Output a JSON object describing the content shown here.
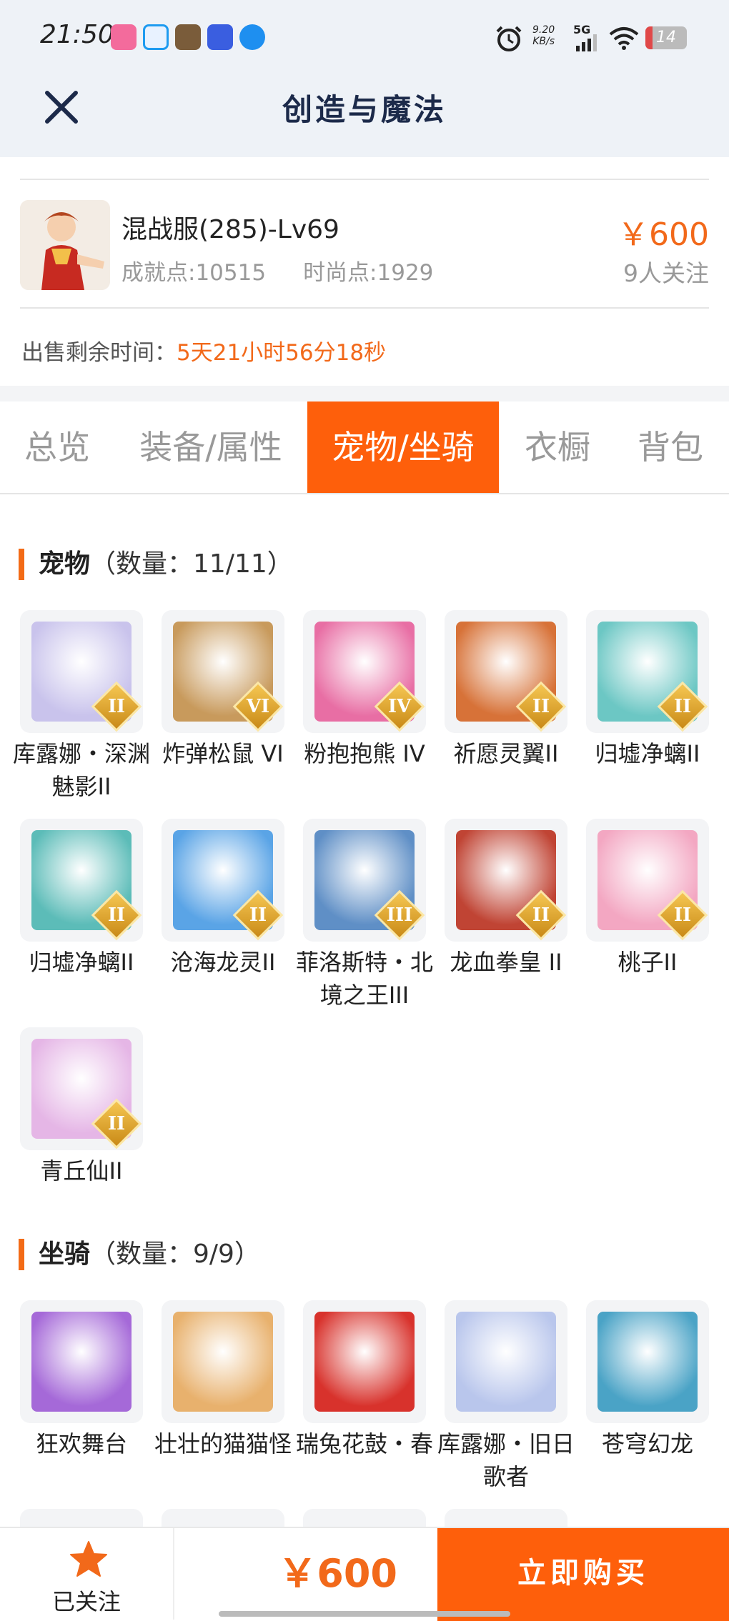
{
  "status_bar": {
    "time": "21:50",
    "net_speed_value": "9.20",
    "net_speed_unit": "KB/s",
    "network": "5G",
    "battery": "14",
    "apps": [
      {
        "name": "bilibili-icon",
        "color": "#f36b9c"
      },
      {
        "name": "qq-icon",
        "color": "#1e9bf0"
      },
      {
        "name": "game-icon",
        "color": "#7a5c3a"
      },
      {
        "name": "tieba-icon",
        "color": "#3a5ee0"
      },
      {
        "name": "k-app-icon",
        "color": "#1e8ff0"
      }
    ]
  },
  "nav": {
    "title": "创造与魔法"
  },
  "product": {
    "name": "混战服(285)-Lv69",
    "achievement": "成就点:10515",
    "fashion": "时尚点:1929",
    "price": "￥600",
    "followers": "9人关注"
  },
  "sale": {
    "label": "出售剩余时间：",
    "remaining": "5天21小时56分18秒"
  },
  "tabs": [
    {
      "label": "总览",
      "active": false
    },
    {
      "label": "装备/属性",
      "active": false
    },
    {
      "label": "宠物/坐骑",
      "active": true
    },
    {
      "label": "衣橱",
      "active": false
    },
    {
      "label": "背包",
      "active": false
    }
  ],
  "pets": {
    "title": "宠物",
    "count": "（数量：11/11）",
    "items": [
      {
        "label": "库露娜・深渊魅影II",
        "badge": "II",
        "color": "#c9c3ec"
      },
      {
        "label": "炸弹松鼠 VI",
        "badge": "VI",
        "color": "#c89a5c"
      },
      {
        "label": "粉抱抱熊 IV",
        "badge": "IV",
        "color": "#e86ea4"
      },
      {
        "label": "祈愿灵翼II",
        "badge": "II",
        "color": "#d77238"
      },
      {
        "label": "归墟净螭II",
        "badge": "II",
        "color": "#6cc7c4"
      },
      {
        "label": "归墟净螭II",
        "badge": "II",
        "color": "#5cbcb8"
      },
      {
        "label": "沧海龙灵II",
        "badge": "II",
        "color": "#5aa4e6"
      },
      {
        "label": "菲洛斯特・北境之王III",
        "badge": "III",
        "color": "#5f8fc6"
      },
      {
        "label": "龙血拳皇 II",
        "badge": "II",
        "color": "#c04434"
      },
      {
        "label": "桃子II",
        "badge": "II",
        "color": "#f3a7c2"
      },
      {
        "label": "青丘仙II",
        "badge": "II",
        "color": "#e5b6e6"
      }
    ]
  },
  "mounts": {
    "title": "坐骑",
    "count": "（数量：9/9）",
    "items": [
      {
        "label": "狂欢舞台",
        "color": "#a569d8"
      },
      {
        "label": "壮壮的猫猫怪",
        "color": "#e8b16d"
      },
      {
        "label": "瑞兔花鼓・春",
        "color": "#d8322c"
      },
      {
        "label": "库露娜・旧日歌者",
        "color": "#b9c6ec"
      },
      {
        "label": "苍穹幻龙",
        "color": "#4aa3c6"
      }
    ]
  },
  "bottom": {
    "follow_label": "已关注",
    "price": "￥600",
    "buy_label": "立即购买"
  }
}
